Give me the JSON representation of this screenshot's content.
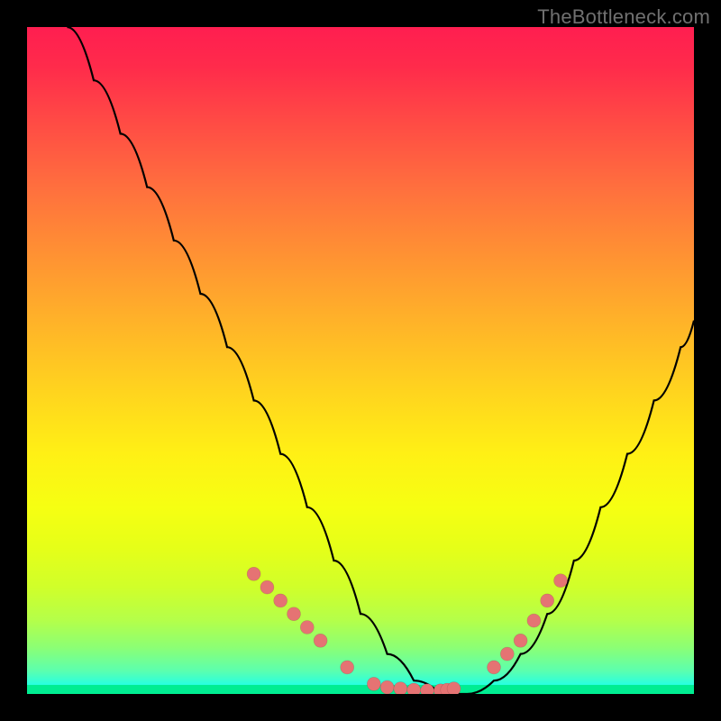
{
  "watermark": "TheBottleneck.com",
  "chart_data": {
    "type": "line",
    "title": "",
    "xlabel": "",
    "ylabel": "",
    "xlim": [
      0,
      100
    ],
    "ylim": [
      0,
      100
    ],
    "grid": false,
    "legend": false,
    "series": [
      {
        "name": "bottleneck-curve",
        "x": [
          6,
          10,
          14,
          18,
          22,
          26,
          30,
          34,
          38,
          42,
          46,
          50,
          54,
          58,
          62,
          66,
          70,
          74,
          78,
          82,
          86,
          90,
          94,
          98,
          100
        ],
        "values": [
          100,
          92,
          84,
          76,
          68,
          60,
          52,
          44,
          36,
          28,
          20,
          12,
          6,
          2,
          0,
          0,
          2,
          6,
          12,
          20,
          28,
          36,
          44,
          52,
          56
        ]
      }
    ],
    "markers": {
      "name": "highlight-dots",
      "x": [
        34,
        36,
        38,
        40,
        42,
        44,
        48,
        52,
        54,
        56,
        58,
        60,
        62,
        63,
        64,
        70,
        72,
        74,
        76,
        78,
        80
      ],
      "values": [
        18,
        16,
        14,
        12,
        10,
        8,
        4,
        1.5,
        1,
        0.8,
        0.6,
        0.5,
        0.5,
        0.6,
        0.8,
        4,
        6,
        8,
        11,
        14,
        17
      ]
    },
    "gradient": {
      "top": "#ff1e50",
      "mid": "#fff015",
      "bottom": "#00ed92"
    }
  }
}
